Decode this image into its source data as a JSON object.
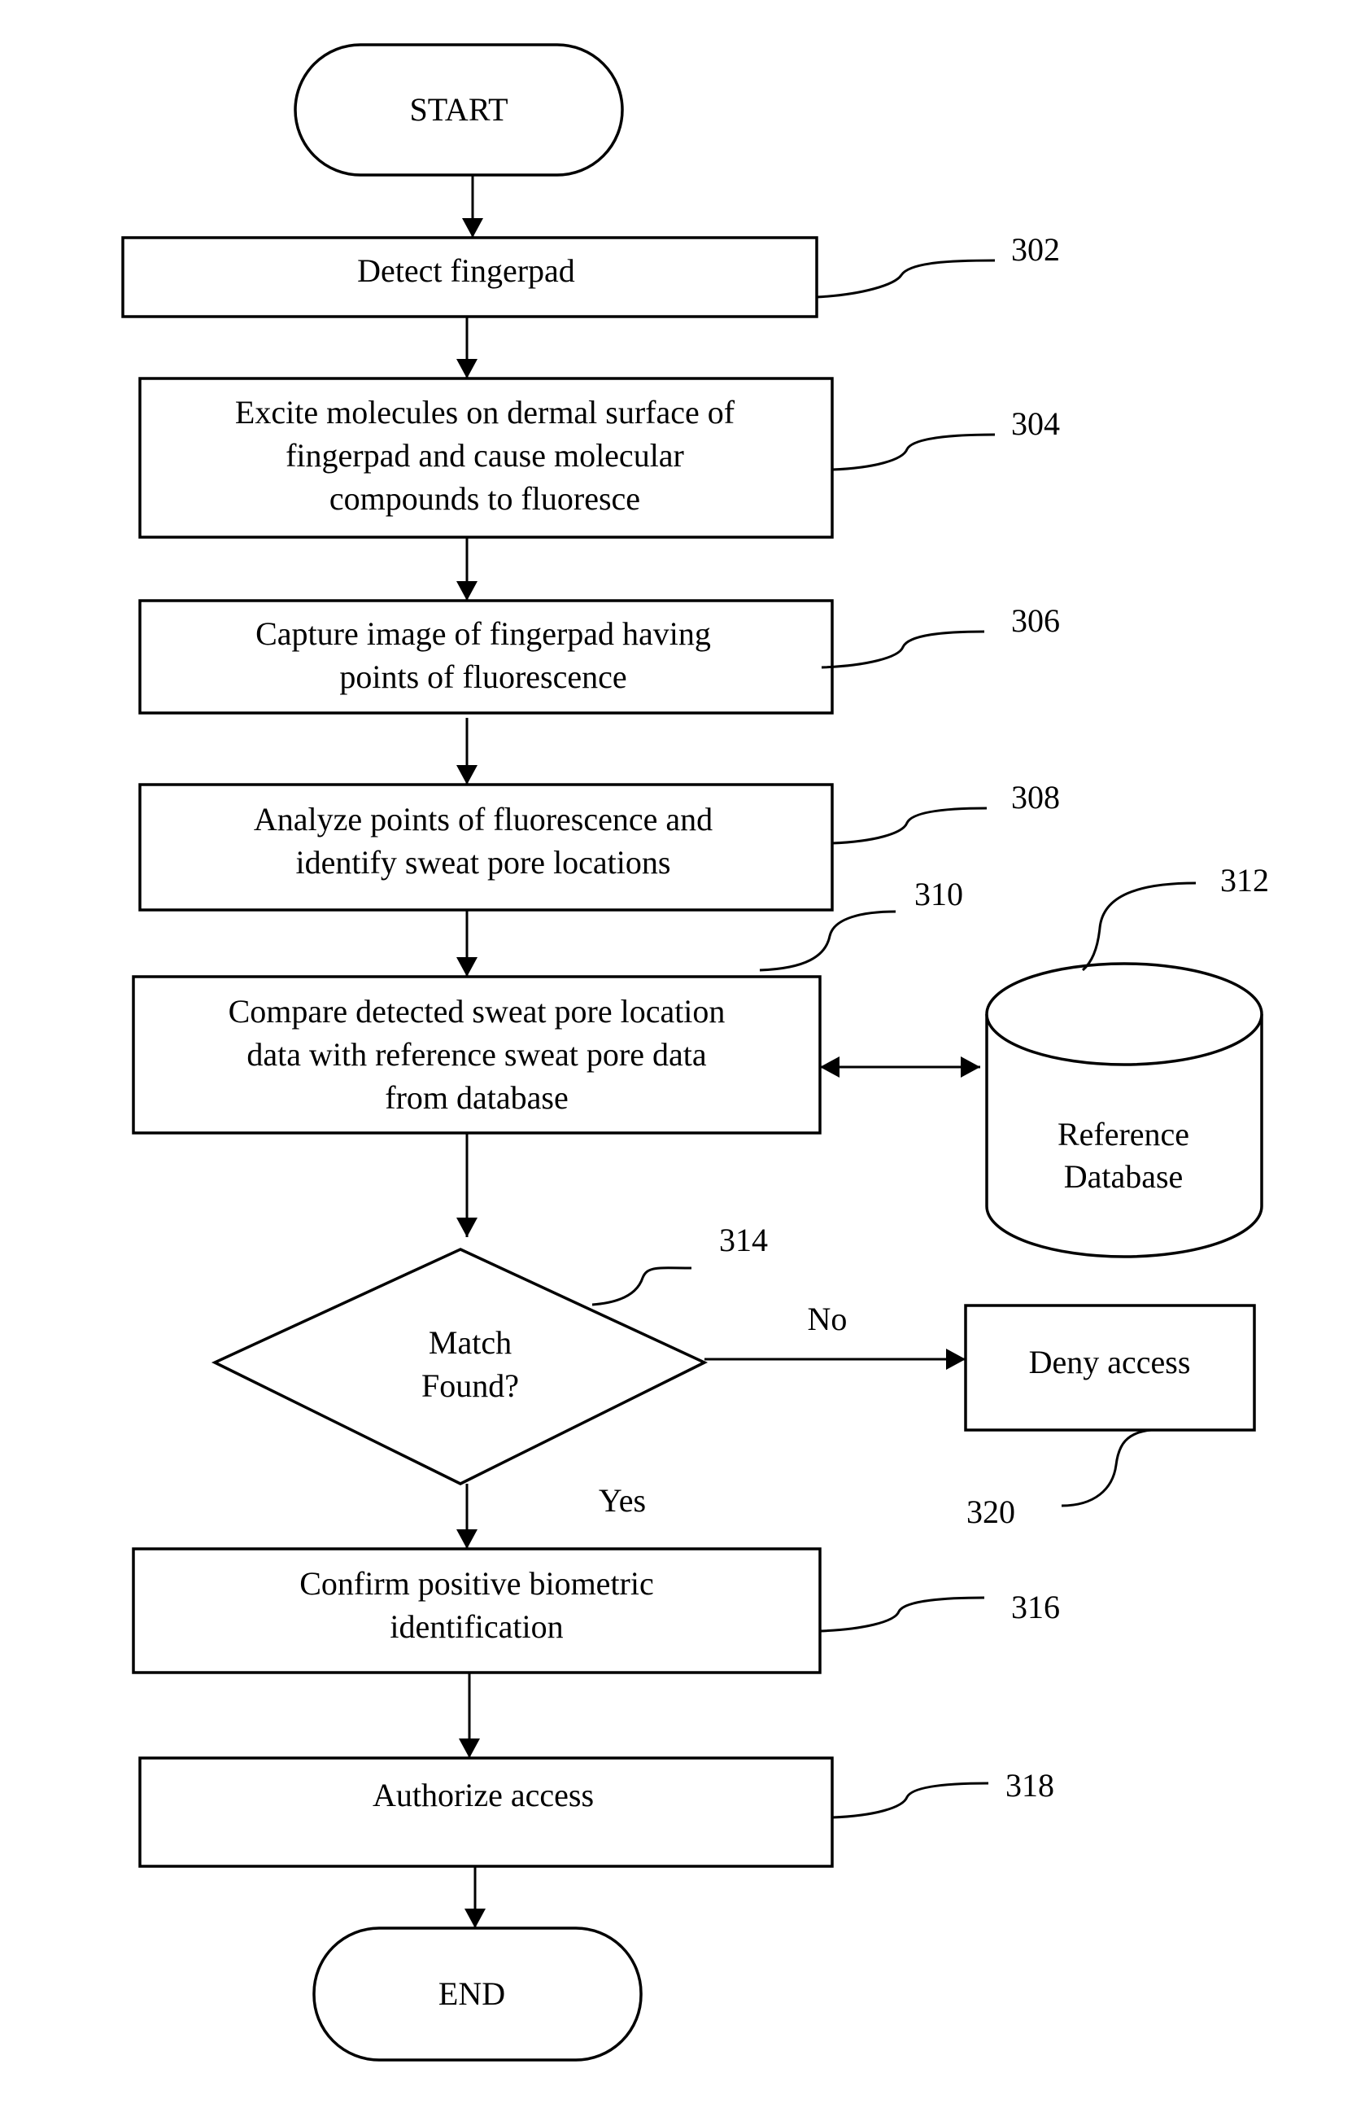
{
  "figure": {
    "type": "flowchart",
    "theme": {
      "line_color": "#000000",
      "background": "#ffffff"
    }
  },
  "nodes": {
    "start": {
      "kind": "terminator",
      "lines": [
        "START"
      ]
    },
    "detect": {
      "kind": "process",
      "ref": "302",
      "lines": [
        "Detect fingerpad"
      ]
    },
    "excite": {
      "kind": "process",
      "ref": "304",
      "lines": [
        "Excite molecules on dermal surface of",
        "fingerpad and cause molecular",
        "compounds to fluoresce"
      ]
    },
    "capture": {
      "kind": "process",
      "ref": "306",
      "lines": [
        "Capture image of fingerpad having",
        "points of fluorescence"
      ]
    },
    "analyze": {
      "kind": "process",
      "ref": "308",
      "lines": [
        "Analyze points of fluorescence and",
        "identify sweat pore locations"
      ]
    },
    "compare": {
      "kind": "process",
      "ref": "310",
      "lines": [
        "Compare detected sweat pore location",
        "data with reference sweat pore data",
        "from database"
      ]
    },
    "database": {
      "kind": "database",
      "ref": "312",
      "lines": [
        "Reference",
        "Database"
      ]
    },
    "decision": {
      "kind": "decision",
      "ref": "314",
      "lines": [
        "Match",
        "Found?"
      ]
    },
    "deny": {
      "kind": "process",
      "ref": "320",
      "lines": [
        "Deny access"
      ]
    },
    "confirm": {
      "kind": "process",
      "ref": "316",
      "lines": [
        "Confirm positive biometric",
        "identification"
      ]
    },
    "authorize": {
      "kind": "process",
      "ref": "318",
      "lines": [
        "Authorize access"
      ]
    },
    "end": {
      "kind": "terminator",
      "lines": [
        "END"
      ]
    }
  },
  "edges": [
    {
      "from": "start",
      "to": "detect",
      "label": ""
    },
    {
      "from": "detect",
      "to": "excite",
      "label": ""
    },
    {
      "from": "excite",
      "to": "capture",
      "label": ""
    },
    {
      "from": "capture",
      "to": "analyze",
      "label": ""
    },
    {
      "from": "analyze",
      "to": "compare",
      "label": ""
    },
    {
      "from": "compare",
      "to": "database",
      "label": "",
      "bidirectional": true
    },
    {
      "from": "compare",
      "to": "decision",
      "label": ""
    },
    {
      "from": "decision",
      "to": "deny",
      "label": "No"
    },
    {
      "from": "decision",
      "to": "confirm",
      "label": "Yes"
    },
    {
      "from": "confirm",
      "to": "authorize",
      "label": ""
    },
    {
      "from": "authorize",
      "to": "end",
      "label": ""
    }
  ]
}
